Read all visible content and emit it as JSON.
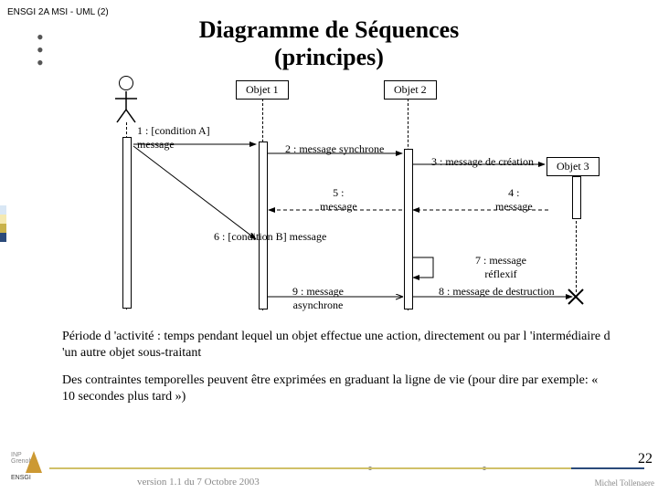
{
  "header": {
    "course": "ENSGI 2A MSI - UML (2)"
  },
  "title": "Diagramme de Séquences\n(principes)",
  "objects": {
    "o1": "Objet 1",
    "o2": "Objet 2",
    "o3": "Objet 3"
  },
  "messages": {
    "m1": "1 : [condition A]\nmessage",
    "m2": "2 : message synchrone",
    "m3": "3 : message de création",
    "m4": "4 :\nmessage",
    "m5": "5 :\nmessage",
    "m6": "6 : [condition B] message",
    "m7": "7 : message\nréflexif",
    "m8": "8 : message de destruction",
    "m9": "9 : message\nasynchrone"
  },
  "paragraphs": {
    "p1": "Période d 'activité : temps pendant lequel un objet effectue une action, directement ou par l 'intermédiaire d 'un autre objet sous-traitant",
    "p2": "Des contraintes temporelles peuvent être exprimées en graduant la ligne de vie (pour dire par exemple: « 10 secondes plus tard »)"
  },
  "footer": {
    "version": "version 1.1 du 7 Octobre 2003",
    "author": "Michel Tollenaere",
    "page": "22"
  },
  "logo": {
    "top": "INP Grenoble",
    "bottom": "ENSGI"
  },
  "colors": {
    "s1": "#d9e7f5",
    "s2": "#f5e9b0",
    "s3": "#c9b24a",
    "s4": "#2b4a7a"
  }
}
